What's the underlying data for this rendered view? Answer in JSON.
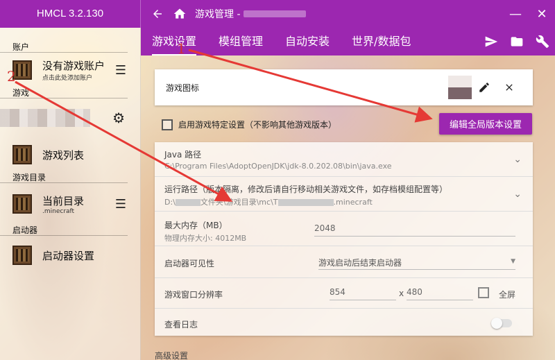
{
  "app": {
    "title": "HMCL 3.2.130",
    "window_title": "游戏管理 -"
  },
  "window_controls": {
    "minimize": "—",
    "close": "✕"
  },
  "sidebar": {
    "accounts_header": "账户",
    "account_name": "没有游戏账户",
    "account_hint": "点击此处添加账户",
    "game_header": "游戏",
    "game_list": "游戏列表",
    "dir_header": "游戏目录",
    "current_dir": "当前目录",
    "current_dir_sub": ".minecraft",
    "launcher_header": "启动器",
    "launcher_settings": "启动器设置"
  },
  "tabs": [
    {
      "label": "游戏设置"
    },
    {
      "label": "模组管理"
    },
    {
      "label": "自动安装"
    },
    {
      "label": "世界/数据包"
    }
  ],
  "game_icon": {
    "label": "游戏图标"
  },
  "specific_settings": {
    "label": "启用游戏特定设置（不影响其他游戏版本）"
  },
  "edit_global_button": "编辑全局版本设置",
  "java": {
    "label": "Java 路径",
    "value": "C:\\Program Files\\AdoptOpenJDK\\jdk-8.0.202.08\\bin\\java.exe"
  },
  "run_path": {
    "label": "运行路径（版本隔离，修改后请自行移动相关游戏文件，如存档模组配置等）",
    "value_prefix": "D:\\",
    "value_mid": "文件夹\\游戏目录\\mc\\T",
    "value_suffix": ".minecraft"
  },
  "memory": {
    "label": "最大内存（MB）",
    "physical": "物理内存大小: 4012MB",
    "value": "2048"
  },
  "visibility": {
    "label": "启动器可见性",
    "value": "游戏启动后结束启动器"
  },
  "resolution": {
    "label": "游戏窗口分辨率",
    "width": "854",
    "sep": "x",
    "height": "480",
    "fullscreen": "全屏"
  },
  "log": {
    "label": "查看日志"
  },
  "advanced": {
    "label": "高级设置"
  },
  "annotations": {
    "one": "1",
    "two": "2"
  },
  "colors": {
    "accent": "#9c27b0",
    "arrow": "#e53935"
  },
  "icons": {
    "back": "back-arrow-icon",
    "home": "home-icon",
    "send": "paper-plane-icon",
    "folder": "folder-icon",
    "wrench": "wrench-icon"
  }
}
